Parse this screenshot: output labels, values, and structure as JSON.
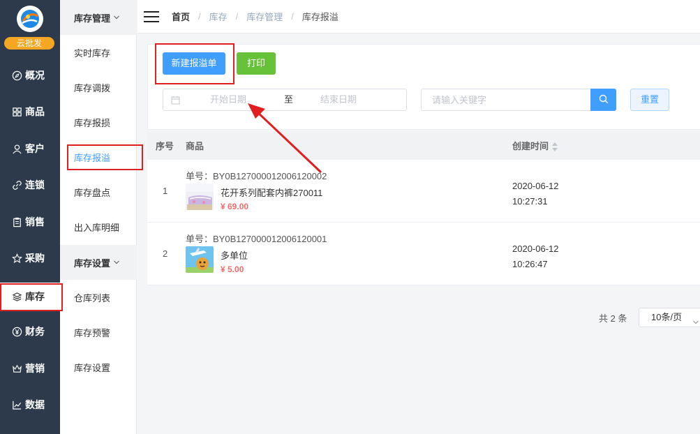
{
  "brand": {
    "badge": "云批发"
  },
  "nav": {
    "items": [
      {
        "label": "概况",
        "icon": "compass-icon"
      },
      {
        "label": "商品",
        "icon": "grid-icon"
      },
      {
        "label": "客户",
        "icon": "user-icon"
      },
      {
        "label": "连锁",
        "icon": "link-icon"
      },
      {
        "label": "销售",
        "icon": "clipboard-icon"
      },
      {
        "label": "采购",
        "icon": "star-icon"
      },
      {
        "label": "库存",
        "icon": "layers-icon",
        "active": true
      },
      {
        "label": "财务",
        "icon": "yen-circle-icon"
      },
      {
        "label": "营销",
        "icon": "crown-icon"
      },
      {
        "label": "数据",
        "icon": "chart-icon"
      }
    ]
  },
  "subnav": {
    "group1": "库存管理",
    "group1_items": [
      "实时库存",
      "库存调拨",
      "库存报损",
      "库存报溢",
      "库存盘点",
      "出入库明细"
    ],
    "active": "库存报溢",
    "group2": "库存设置",
    "group2_items": [
      "仓库列表",
      "库存预警",
      "库存设置"
    ]
  },
  "breadcrumb": [
    "首页",
    "库存",
    "库存管理",
    "库存报溢"
  ],
  "toolbar": {
    "new_label": "新建报溢单",
    "print_label": "打印"
  },
  "filters": {
    "start_placeholder": "开始日期",
    "to_label": "至",
    "end_placeholder": "结束日期",
    "search_placeholder": "请输入关键字",
    "reset_label": "重置"
  },
  "table": {
    "headers": {
      "index": "序号",
      "product": "商品",
      "created": "创建时间"
    },
    "rows": [
      {
        "index": "1",
        "order_no": "单号：BY0B127000012006120002",
        "name": "花开系列配套内裤270011",
        "price": "¥ 69.00",
        "date": "2020-06-12",
        "time": "10:27:31"
      },
      {
        "index": "2",
        "order_no": "单号：BY0B127000012006120001",
        "name": "多单位",
        "price": "¥ 5.00",
        "date": "2020-06-12",
        "time": "10:26:47"
      }
    ]
  },
  "pager": {
    "total": "共 2 条",
    "page_size": "10条/页"
  },
  "colors": {
    "primary": "#409eff",
    "success": "#67c23a",
    "nav_bg": "#2c3a4b",
    "price": "#f56c6c",
    "annotation": "#e02020",
    "badge": "#f5a623"
  }
}
